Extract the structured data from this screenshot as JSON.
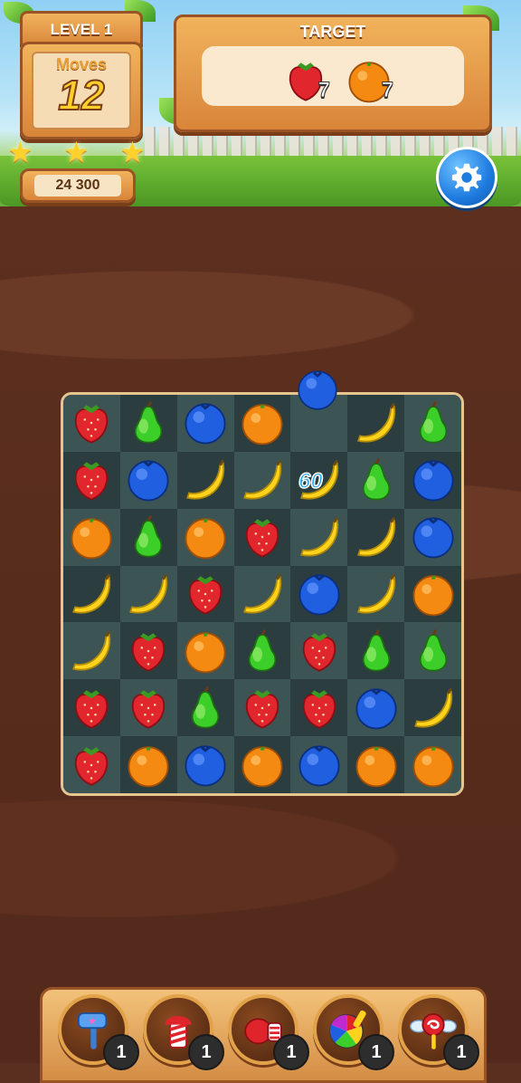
{
  "header": {
    "level_label": "LEVEL 1",
    "moves_label": "Moves",
    "moves_value": "12",
    "score": "24 300",
    "stars_earned": 3
  },
  "target": {
    "title": "TARGET",
    "items": [
      {
        "fruit": "strawberry",
        "count": "7"
      },
      {
        "fruit": "orange",
        "count": "7"
      }
    ]
  },
  "settings_icon": "gear-icon",
  "board": {
    "rows": 7,
    "cols": 7,
    "grid": [
      [
        "strawberry",
        "pear",
        "blueberry",
        "orange",
        "empty",
        "banana",
        "pear"
      ],
      [
        "strawberry",
        "blueberry",
        "banana",
        "banana",
        "banana",
        "pear",
        "blueberry"
      ],
      [
        "orange",
        "pear",
        "orange",
        "strawberry",
        "banana",
        "banana",
        "blueberry"
      ],
      [
        "banana",
        "banana",
        "strawberry",
        "banana",
        "blueberry",
        "banana",
        "orange"
      ],
      [
        "banana",
        "strawberry",
        "orange",
        "pear",
        "strawberry",
        "pear",
        "pear"
      ],
      [
        "strawberry",
        "strawberry",
        "pear",
        "strawberry",
        "strawberry",
        "blueberry",
        "banana"
      ],
      [
        "strawberry",
        "orange",
        "blueberry",
        "orange",
        "blueberry",
        "orange",
        "orange"
      ]
    ],
    "falling_fruit": "blueberry",
    "combo_popup": "60"
  },
  "boosters": [
    {
      "name": "hammer",
      "count": "1"
    },
    {
      "name": "firework-rocket",
      "count": "1"
    },
    {
      "name": "boxing-glove",
      "count": "1"
    },
    {
      "name": "rainbow-ball",
      "count": "1"
    },
    {
      "name": "winged-candy",
      "count": "1"
    }
  ],
  "colors": {
    "strawberry": "#e2262e",
    "pear": "#3ccf2a",
    "blueberry": "#1f5fe0",
    "orange": "#f48a12",
    "banana": "#ffd21c",
    "wood": "#d9853a",
    "dirt": "#5d2f1f"
  }
}
